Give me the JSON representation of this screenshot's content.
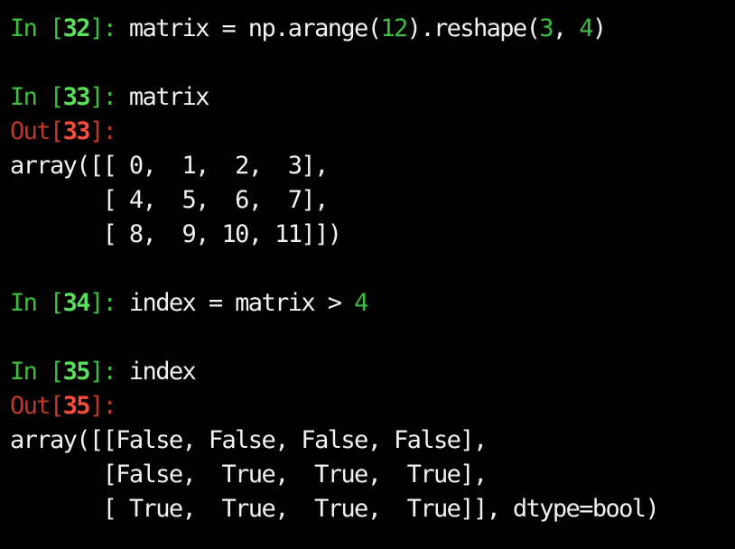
{
  "window": {
    "background": "#000000"
  },
  "colors": {
    "in_prompt": "#3fbf3f",
    "out_prompt": "#c0392b",
    "text": "#f2f2f2",
    "number_literal": "#3fbf3f"
  },
  "cells": [
    {
      "in_label": "In [",
      "in_num": "32",
      "in_close": "]: ",
      "code_parts": [
        {
          "text": "matrix = np.arange(",
          "kind": "code"
        },
        {
          "text": "12",
          "kind": "num"
        },
        {
          "text": ").reshape(",
          "kind": "code"
        },
        {
          "text": "3",
          "kind": "num"
        },
        {
          "text": ", ",
          "kind": "code"
        },
        {
          "text": "4",
          "kind": "num"
        },
        {
          "text": ")",
          "kind": "code"
        }
      ]
    },
    {
      "in_label": "In [",
      "in_num": "33",
      "in_close": "]: ",
      "code": "matrix",
      "out_label": "Out[",
      "out_num": "33",
      "out_close": "]:",
      "output_lines": [
        "array([[ 0,  1,  2,  3],",
        "       [ 4,  5,  6,  7],",
        "       [ 8,  9, 10, 11]])"
      ]
    },
    {
      "in_label": "In [",
      "in_num": "34",
      "in_close": "]: ",
      "code": "index = matrix > ",
      "code_num": "4"
    },
    {
      "in_label": "In [",
      "in_num": "35",
      "in_close": "]: ",
      "code": "index",
      "out_label": "Out[",
      "out_num": "35",
      "out_close": "]:",
      "output_lines": [
        "array([[False, False, False, False],",
        "       [False,  True,  True,  True],",
        "       [ True,  True,  True,  True]], dtype=bool)"
      ]
    }
  ]
}
